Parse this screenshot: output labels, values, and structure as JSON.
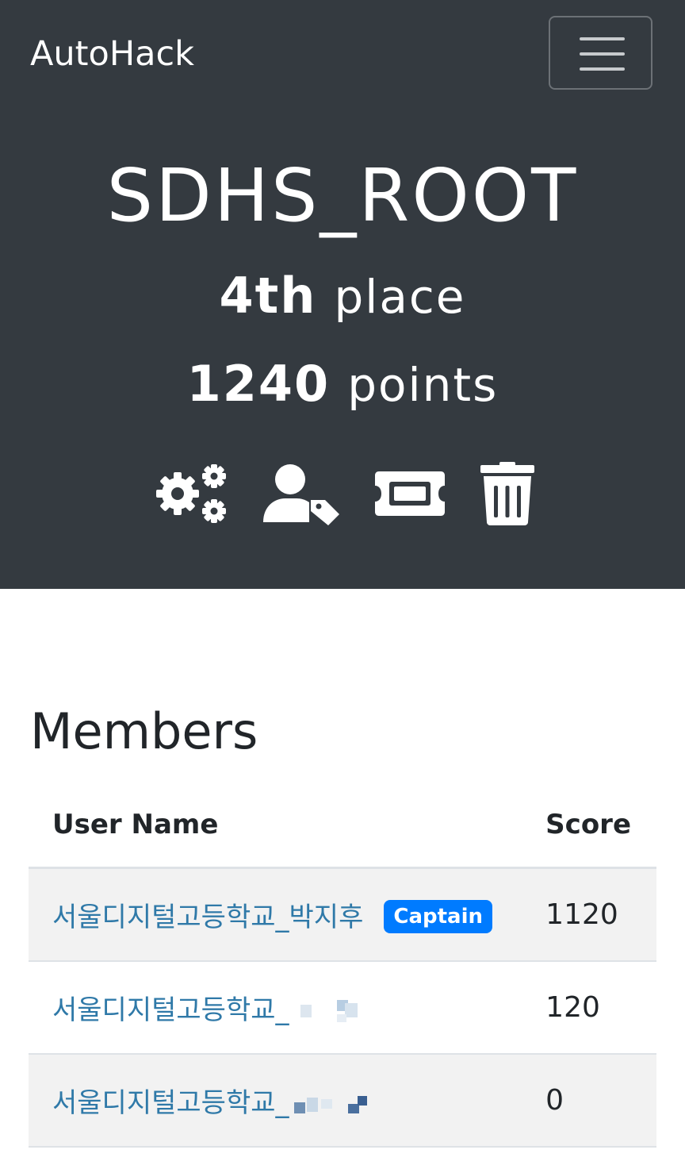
{
  "navbar": {
    "brand": "AutoHack",
    "menu_icon": "hamburger-menu-icon"
  },
  "team": {
    "name": "SDHS_ROOT",
    "place_number": "4th",
    "place_word": "place",
    "points_number": "1240",
    "points_word": "points",
    "actions": [
      {
        "icon": "gears-icon"
      },
      {
        "icon": "user-tag-icon"
      },
      {
        "icon": "ticket-icon"
      },
      {
        "icon": "trash-icon"
      }
    ]
  },
  "members": {
    "title": "Members",
    "columns": [
      "User Name",
      "Score"
    ],
    "rows": [
      {
        "name": "서울디지털고등학교_박지후",
        "badge": "Captain",
        "score": "1120"
      },
      {
        "name": "서울디지털고등학교_",
        "score": "120"
      },
      {
        "name": "서울디지털고등학교_",
        "score": "0"
      }
    ]
  },
  "colors": {
    "header_bg": "#343a40",
    "link": "#2f79a8",
    "badge": "#007bff",
    "stripe": "#f2f2f2"
  }
}
